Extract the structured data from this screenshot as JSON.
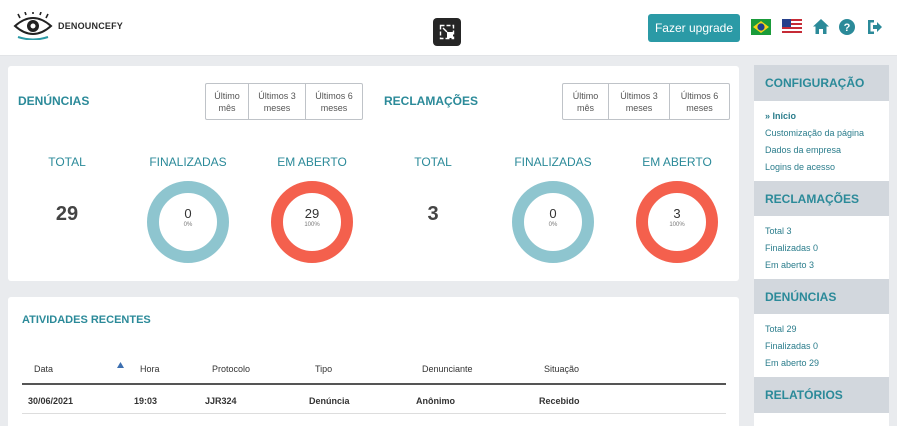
{
  "header": {
    "brand": "DENOUNCEFY",
    "upgrade_label": "Fazer upgrade",
    "icons": [
      "eye-logo-icon",
      "exit-fullscreen-icon",
      "brazil-flag-icon",
      "usa-flag-icon",
      "home-icon",
      "help-icon",
      "logout-icon"
    ]
  },
  "denuncias": {
    "title": "DENÚNCIAS",
    "periods": [
      "Último mês",
      "Últimos 3 meses",
      "Últimos 6 meses"
    ],
    "total_label": "TOTAL",
    "total": "29",
    "finalizadas_label": "FINALIZADAS",
    "finalizadas": "0",
    "finalizadas_pct": "0%",
    "aberto_label": "EM ABERTO",
    "aberto": "29",
    "aberto_pct": "100%"
  },
  "reclamacoes": {
    "title": "RECLAMAÇÕES",
    "periods": [
      "Último mês",
      "Últimos 3 meses",
      "Últimos 6 meses"
    ],
    "total_label": "TOTAL",
    "total": "3",
    "finalizadas_label": "FINALIZADAS",
    "finalizadas": "0",
    "finalizadas_pct": "0%",
    "aberto_label": "EM ABERTO",
    "aberto": "3",
    "aberto_pct": "100%"
  },
  "colors": {
    "accent": "#2b9aa6",
    "finalizadas_ring": "#8ec5cf",
    "aberto_ring": "#f4604d"
  },
  "recent": {
    "title": "ATIVIDADES RECENTES",
    "columns": [
      "Data",
      "Hora",
      "Protocolo",
      "Tipo",
      "Denunciante",
      "Situação"
    ],
    "rows": [
      {
        "data": "30/06/2021",
        "hora": "19:03",
        "protocolo": "JJR324",
        "tipo": "Denúncia",
        "denunciante": "Anônimo",
        "situacao": "Recebido"
      }
    ]
  },
  "sidebar": {
    "config_title": "CONFIGURAÇÃO",
    "config_items": [
      "» Início",
      "Customização da página",
      "Dados da empresa",
      "Logins de acesso"
    ],
    "reclamacoes_title": "RECLAMAÇÕES",
    "reclamacoes_items": [
      "Total 3",
      "Finalizadas 0",
      "Em aberto 3"
    ],
    "denuncias_title": "DENÚNCIAS",
    "denuncias_items": [
      "Total 29",
      "Finalizadas 0",
      "Em aberto 29"
    ],
    "relatorios_title": "RELATÓRIOS"
  }
}
